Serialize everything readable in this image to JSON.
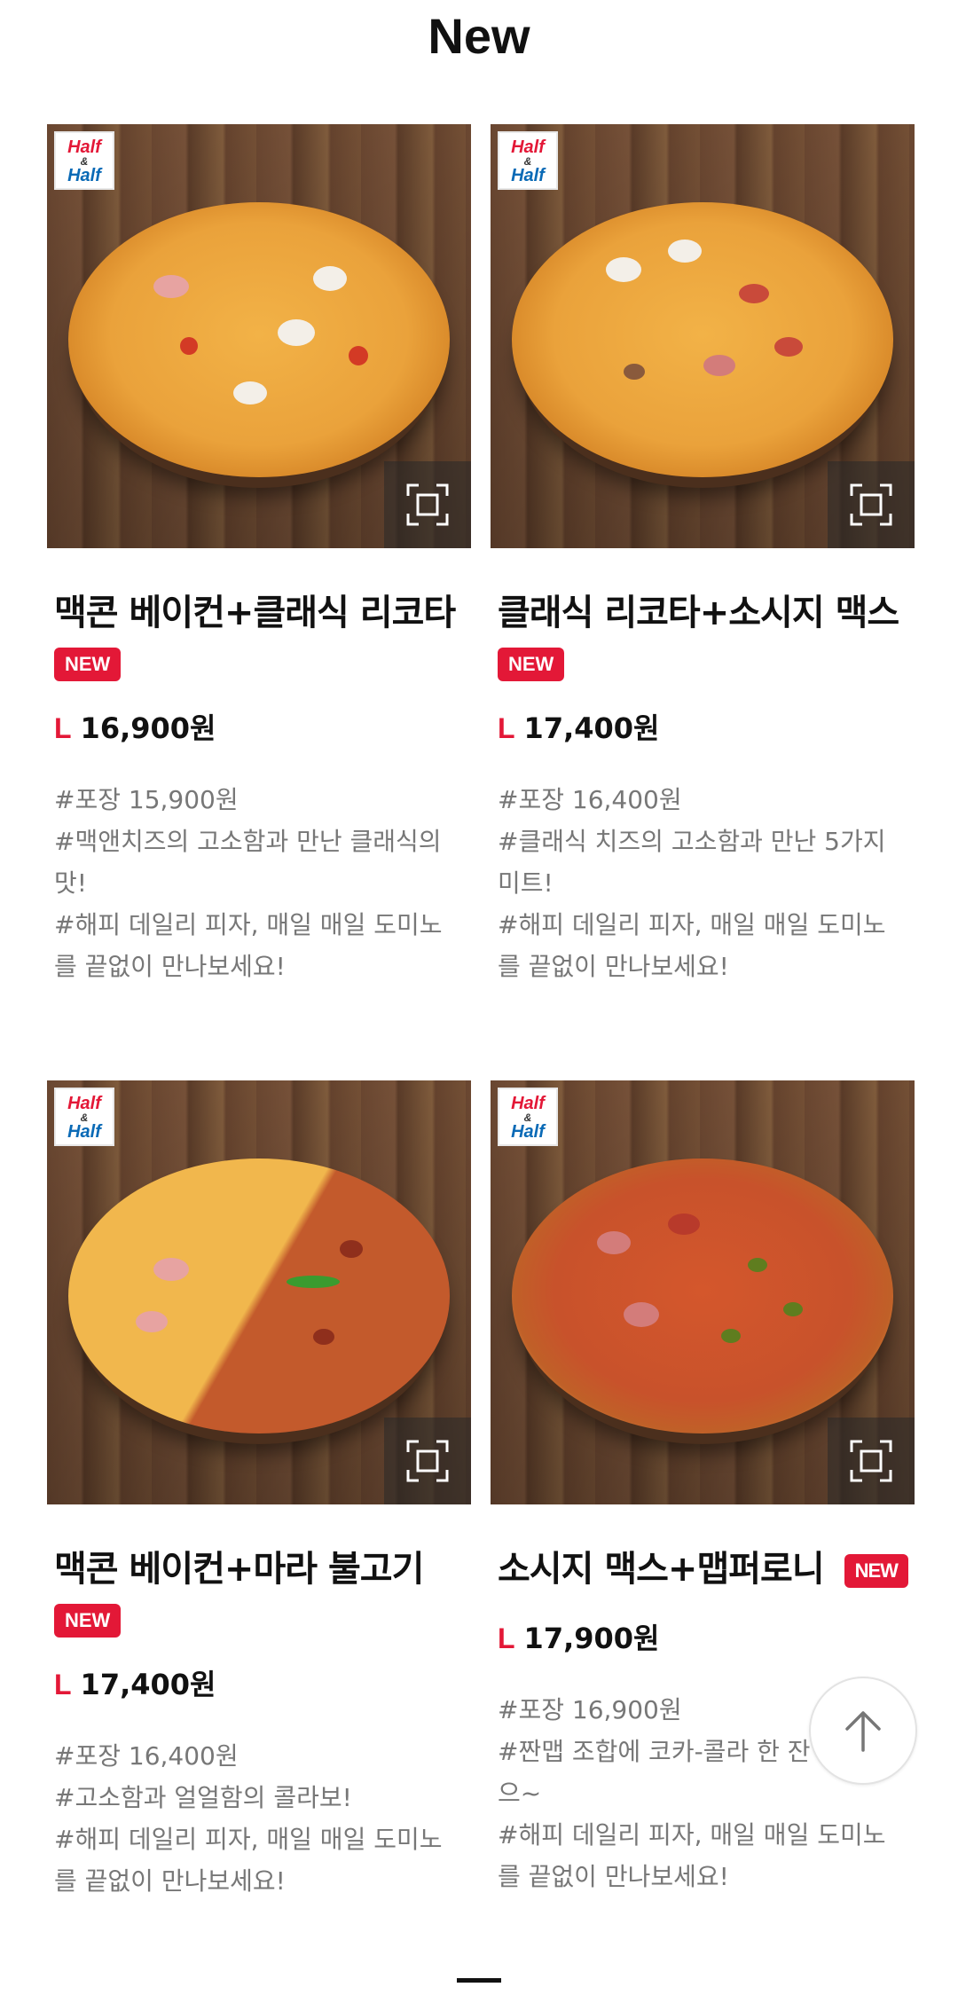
{
  "page": {
    "title": "New"
  },
  "brand": {
    "accent": "#e31837",
    "blue": "#0a6ab6"
  },
  "logo": {
    "line1": "Half",
    "amp": "&",
    "line2": "Half"
  },
  "products": [
    {
      "name": "맥콘 베이컨+클래식 리코타",
      "badge": "NEW",
      "size": "L",
      "price": "16,900원",
      "desc": [
        "#포장 15,900원",
        "#맥앤치즈의 고소함과 만난 클래식의",
        "맛!",
        "#해피 데일리 피자, 매일 매일 도미노",
        "를 끝없이 만나보세요!"
      ]
    },
    {
      "name": "클래식 리코타+소시지 맥스",
      "badge": "NEW",
      "size": "L",
      "price": "17,400원",
      "desc": [
        "#포장 16,400원",
        "#클래식 치즈의 고소함과 만난 5가지",
        "미트!",
        "#해피 데일리 피자, 매일 매일 도미노",
        "를 끝없이 만나보세요!"
      ]
    },
    {
      "name": "맥콘 베이컨+마라 불고기",
      "badge": "NEW",
      "size": "L",
      "price": "17,400원",
      "desc": [
        "#포장 16,400원",
        "#고소함과 얼얼함의 콜라보!",
        "#해피 데일리 피자, 매일 매일 도미노",
        "를 끝없이 만나보세요!"
      ]
    },
    {
      "name": "소시지 맥스+맵퍼로니",
      "badge": "NEW",
      "size": "L",
      "price": "17,900원",
      "desc": [
        "#포장 16,900원",
        "#짠맵 조합에 코카-콜라 한 잔",
        "으~",
        "#해피 데일리 피자, 매일 매일 도미노",
        "를 끝없이 만나보세요!"
      ]
    }
  ],
  "icons": {
    "zoom": "expand-icon",
    "scroll_top": "arrow-up-icon"
  }
}
